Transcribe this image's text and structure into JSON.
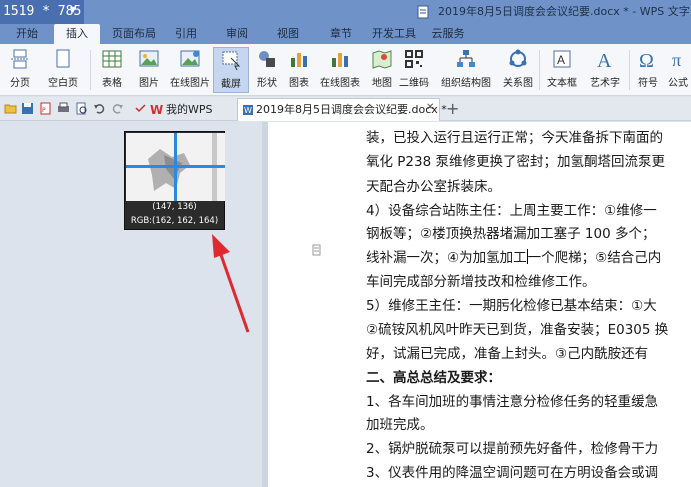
{
  "titlebar": {
    "size_readout": "1519 * 785",
    "document_title": "2019年8月5日调度会会议纪要.docx * - WPS 文字"
  },
  "menu": {
    "tabs": [
      "开始",
      "插入",
      "页面布局",
      "引用",
      "审阅",
      "视图",
      "章节",
      "开发工具",
      "云服务"
    ],
    "active": "插入"
  },
  "ribbon": {
    "buttons": [
      {
        "label": "分页",
        "icon": "page-break-icon"
      },
      {
        "label": "空白页",
        "icon": "blank-page-icon"
      },
      {
        "label": "表格",
        "icon": "table-icon"
      },
      {
        "label": "图片",
        "icon": "picture-icon"
      },
      {
        "label": "在线图片",
        "icon": "online-picture-icon"
      },
      {
        "label": "截屏",
        "icon": "screenshot-icon"
      },
      {
        "label": "形状",
        "icon": "shapes-icon"
      },
      {
        "label": "图表",
        "icon": "chart-icon"
      },
      {
        "label": "在线图表",
        "icon": "online-chart-icon"
      },
      {
        "label": "地图",
        "icon": "map-icon"
      },
      {
        "label": "二维码",
        "icon": "qrcode-icon"
      },
      {
        "label": "组织结构图",
        "icon": "org-chart-icon"
      },
      {
        "label": "关系图",
        "icon": "relation-chart-icon"
      },
      {
        "label": "文本框",
        "icon": "textbox-icon"
      },
      {
        "label": "艺术字",
        "icon": "wordart-icon"
      },
      {
        "label": "符号",
        "icon": "symbol-icon"
      },
      {
        "label": "公式",
        "icon": "formula-icon"
      }
    ],
    "selected": "截屏"
  },
  "doc_tabs": {
    "wps_home": "我的WPS",
    "current": "2019年8月5日调度会会议纪要.docx *"
  },
  "picker": {
    "coords": "(147, 136)",
    "rgb": "RGB:(162, 162, 164)"
  },
  "document": {
    "lines": [
      "装，已投入运行且运行正常；今天准备拆下南面的",
      "氧化 P238 泵维修更换了密封；加氢酮塔回流泵更",
      "天配合办公室拆装床。",
      "4）设备综合站陈主任：上周主要工作：①维修一",
      "钢板等；②楼顶换热器堵漏加工塞子 100 多个；",
      "线补漏一次；④为加氢加工",
      "一个爬梯；⑤结合己内",
      "车间完成部分新增技改和检维修工作。",
      "5）维修王主任：一期肟化检修已基本结束：①大",
      "②硫铵风机风叶昨天已到货，准备安装；E0305 换",
      "好，试漏已完成，准备上封头。③己内酰胺还有",
      "二、高总总结及要求：",
      "1、各车间加班的事情注意分检修任务的轻重缓急",
      "加班完成。",
      "2、锅炉脱硫泵可以提前预先好备件，检修骨干力",
      "3、仪表件用的降温空调问题可在方明设备会或调"
    ]
  }
}
